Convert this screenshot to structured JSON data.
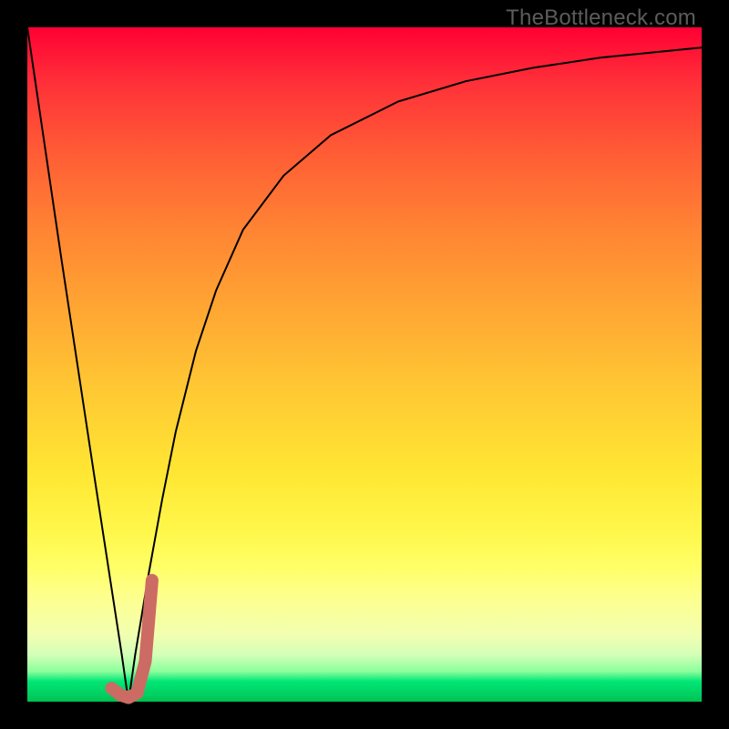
{
  "watermark": {
    "text": "TheBottleneck.com"
  },
  "chart_data": {
    "type": "line",
    "title": "",
    "xlabel": "",
    "ylabel": "",
    "xlim": [
      0,
      100
    ],
    "ylim": [
      0,
      100
    ],
    "grid": false,
    "legend": false,
    "series": [
      {
        "name": "bottleneck-curve",
        "color": "#000000",
        "stroke_width": 2,
        "x": [
          0,
          5,
          10,
          12,
          14,
          15,
          16,
          18,
          20,
          22,
          25,
          28,
          32,
          38,
          45,
          55,
          65,
          75,
          85,
          95,
          100
        ],
        "values": [
          100,
          66,
          33,
          20,
          7,
          0,
          7,
          19,
          30,
          40,
          52,
          61,
          70,
          78,
          84,
          89,
          92,
          94,
          95.5,
          96.5,
          97
        ]
      },
      {
        "name": "j-marker",
        "color": "#cc6b63",
        "stroke_width": 14,
        "line_cap": "round",
        "x": [
          12.5,
          13.8,
          15.0,
          16.3,
          17.5,
          18.0,
          18.5
        ],
        "values": [
          2.0,
          1.0,
          0.6,
          1.3,
          6.0,
          12.0,
          18.0
        ]
      }
    ]
  }
}
